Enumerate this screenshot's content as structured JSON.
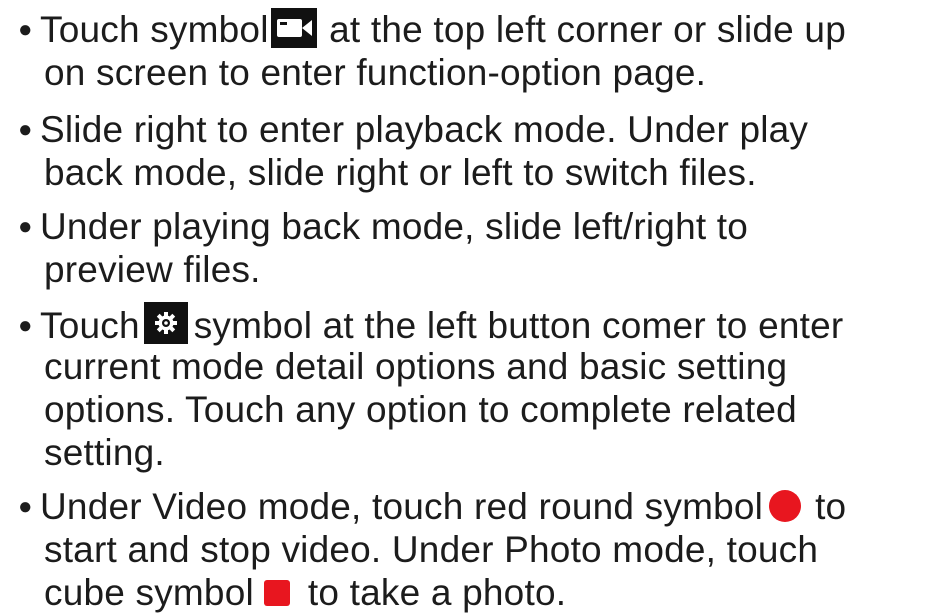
{
  "items": [
    {
      "lines": [
        {
          "before": "Touch symbol",
          "icon": "video-camera-icon",
          "after": " at the top left corner or slide up"
        },
        {
          "text": "on screen to enter function-option page."
        }
      ]
    },
    {
      "lines": [
        {
          "text": "Slide right to enter playback mode. Under play"
        },
        {
          "text": "back mode, slide right or left to switch files."
        }
      ]
    },
    {
      "lines": [
        {
          "text": "Under playing back mode, slide left/right to"
        },
        {
          "text": "preview files."
        }
      ]
    },
    {
      "lines": [
        {
          "before": "Touch",
          "icon": "settings-gear-icon",
          "after": "symbol at the left button comer to enter"
        },
        {
          "text": "current mode detail options and basic setting"
        },
        {
          "text": "options. Touch any option to complete related"
        },
        {
          "text": "setting."
        }
      ]
    },
    {
      "lines": [
        {
          "before": "Under Video mode, touch red round symbol",
          "icon": "red-circle-icon",
          "after": "to"
        },
        {
          "text": "start and stop video. Under Photo mode, touch"
        },
        {
          "before": "cube symbol",
          "icon": "red-square-icon",
          "after": "to take a photo."
        }
      ]
    }
  ],
  "bullet_char": "●",
  "colors": {
    "text": "#1c1c1c",
    "icon_background": "#111111",
    "record_red": "#e8161f"
  }
}
